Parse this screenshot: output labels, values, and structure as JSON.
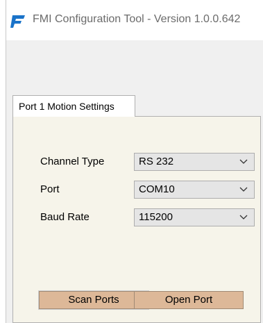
{
  "window": {
    "title": "FMI Configuration Tool  - Version 1.0.0.642",
    "accent_color": "#1a73c9"
  },
  "tabs": [
    {
      "label": "Port 1 Motion Settings",
      "selected": true
    }
  ],
  "settings": {
    "channel_type": {
      "label": "Channel Type",
      "value": "RS 232"
    },
    "port": {
      "label": "Port",
      "value": "COM10"
    },
    "baud_rate": {
      "label": "Baud Rate",
      "value": "115200"
    }
  },
  "buttons": {
    "scan_ports": "Scan Ports",
    "open_port": "Open Port"
  },
  "icons": {
    "app": "fmi-logo-icon",
    "dropdown": "chevron-down-icon"
  }
}
